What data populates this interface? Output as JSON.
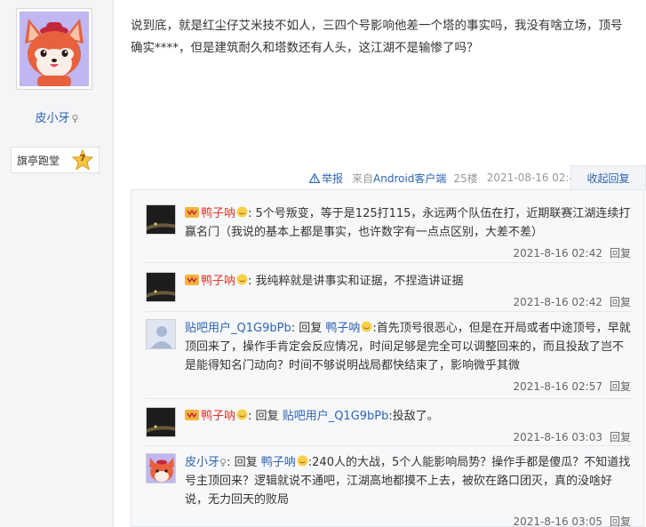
{
  "author": {
    "name": "皮小牙",
    "gender_symbol": "♀",
    "badge_label": "旗亭跑堂",
    "level": "7"
  },
  "post": {
    "content": "说到底，就是红尘仔艾米技不如人，三四个号影响他差一个塔的事实吗，我没有啥立场，顶号确实****，但是建筑耐久和塔数还有人头，这江湖不是输惨了吗？",
    "report_label": "举报",
    "client_prefix": "来自",
    "client_name": "Android客户端",
    "floor": "25楼",
    "time": "2021-08-16 02:40",
    "collapse_label": "收起回复"
  },
  "replies": [
    {
      "user": "鸭子呐",
      "content": ": 5个号叛变，等于是125打115，永远两个队伍在打，近期联赛江湖连续打赢名门（我说的基本上都是事实，也许数字有一点点区别，大差不差）",
      "time": "2021-8-16 02:42",
      "reply_label": "回复"
    },
    {
      "user": "鸭子呐",
      "content": ": 我纯粹就是讲事实和证据，不捏造讲证据",
      "time": "2021-8-16 02:42",
      "reply_label": "回复"
    },
    {
      "user": "贴吧用户_Q1G9bPb",
      "reply_word": "回复",
      "target": "鸭子呐",
      "content": ":首先顶号很恶心，但是在开局或者中途顶号，早就顶回来了，操作手肯定会反应情况，时间足够是完全可以调整回来的，而且投敌了岂不是能得知名门动向？时间不够说明战局都快结束了，影响微乎其微",
      "time": "2021-8-16 02:57",
      "reply_label": "回复"
    },
    {
      "user": "鸭子呐",
      "reply_word": "回复",
      "target": "贴吧用户_Q1G9bPb",
      "content": ":投敌了。",
      "time": "2021-8-16 03:03",
      "reply_label": "回复"
    },
    {
      "user": "皮小牙",
      "gender_symbol": "♀",
      "reply_word": "回复",
      "target": "鸭子呐",
      "content": ":240人的大战，5个人能影响局势？操作手都是傻瓜？不知道找号主顶回来？逻辑就说不通吧，江湖高地都摸不上去，被砍在路口团灭，真的没啥好说，无力回天的败局",
      "time": "2021-8-16 03:05",
      "reply_label": "回复"
    }
  ],
  "colors": {
    "link_blue": "#2d64b3",
    "vip_red": "#e1362b",
    "reply_bg": "#f7f8fa",
    "avatar_bg": "#bfb6f2",
    "fox_orange": "#e8613d"
  }
}
